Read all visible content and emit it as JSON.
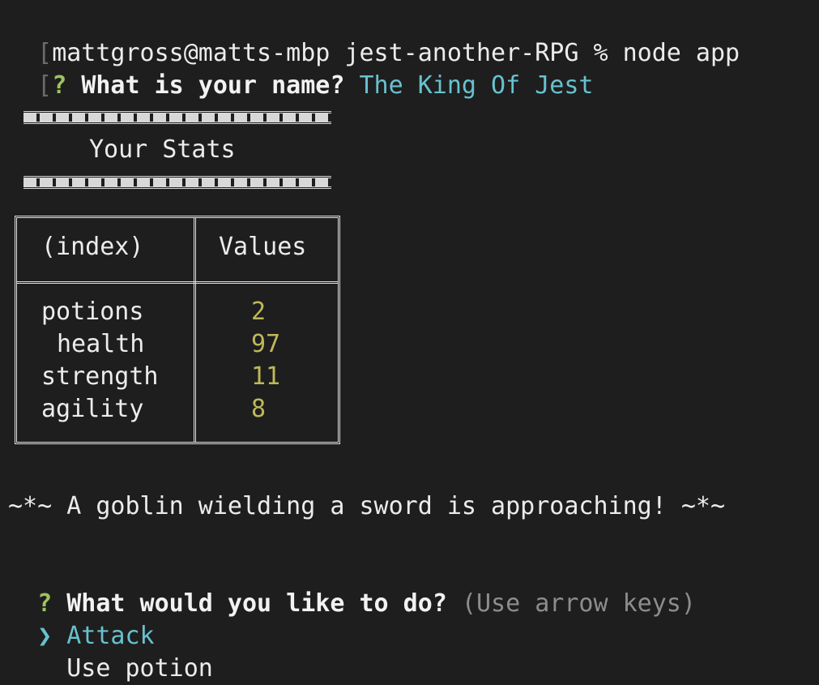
{
  "terminal": {
    "prompt_line": "mattgross@matts-mbp jest-another-RPG % node app",
    "name_question": {
      "mark": "?",
      "text": "What is your name?",
      "answer": "The King Of Jest"
    },
    "stats_title": "Your Stats",
    "stats_table": {
      "headers": [
        "(index)",
        "Values"
      ],
      "rows": [
        {
          "index": "potions",
          "value": "2"
        },
        {
          "index": "health",
          "value": "97"
        },
        {
          "index": "strength",
          "value": "11"
        },
        {
          "index": "agility",
          "value": "8"
        }
      ]
    },
    "encounter_message": "~*~ A goblin wielding a sword is approaching! ~*~",
    "action_question": {
      "mark": "?",
      "text": "What would you like to do?",
      "hint": "(Use arrow keys)"
    },
    "menu": {
      "pointer": "❯",
      "options": [
        "Attack",
        "Use potion"
      ],
      "selected_index": 0
    }
  },
  "colors": {
    "background": "#1e1e1e",
    "answer": "#67c2cf",
    "question_mark": "#9ec35f",
    "value": "#bdb95a",
    "hint": "#8d8d8d"
  }
}
